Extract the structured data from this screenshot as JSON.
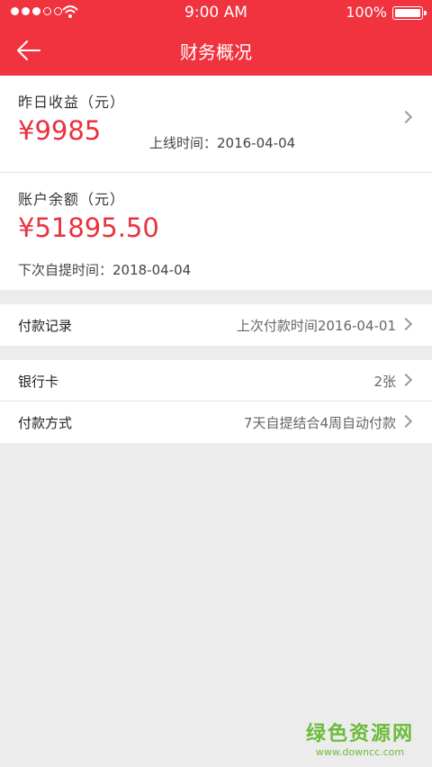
{
  "status_bar": {
    "time": "9:00 AM",
    "battery": "100%"
  },
  "nav": {
    "title": "财务概况"
  },
  "yesterday": {
    "label": "昨日收益（元）",
    "amount": "¥9985",
    "online_time": "上线时间：2016-04-04"
  },
  "balance": {
    "label": "账户余额（元）",
    "amount": "¥51895.50",
    "next_withdraw": "下次自提时间：2018-04-04"
  },
  "payment_record": {
    "label": "付款记录",
    "value": "上次付款时间2016-04-01"
  },
  "bank_card": {
    "label": "银行卡",
    "value": "2张"
  },
  "payment_method": {
    "label": "付款方式",
    "value": "7天自提结合4周自动付款"
  },
  "watermark": {
    "main": "绿色资源网",
    "url": "www.downcc.com"
  },
  "colors": {
    "accent": "#f0333f",
    "amount": "#e9323f"
  }
}
